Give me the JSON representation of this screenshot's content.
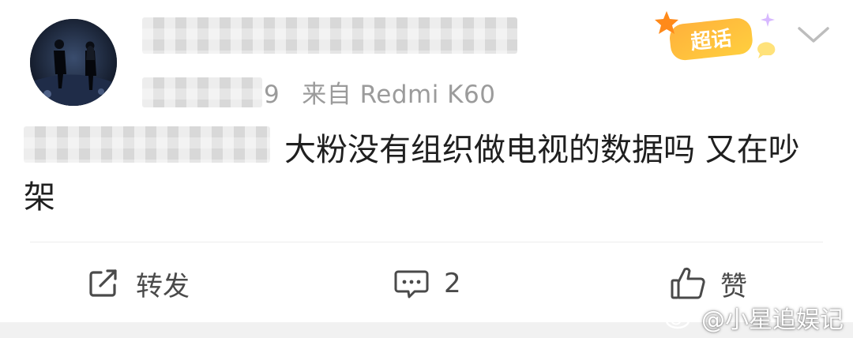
{
  "post": {
    "meta_suffix": "9",
    "source_prefix": "来自",
    "device": "Redmi K60",
    "badge_label": "超话",
    "content": "大粉没有组织做电视的数据吗 又在吵架"
  },
  "actions": {
    "repost_label": "转发",
    "comment_count": "2",
    "like_label": "赞"
  },
  "watermark": {
    "text": "@小星追娱记"
  },
  "colors": {
    "meta": "#9b9b9b",
    "content": "#1f1f1f",
    "badge_orange": "#ff9f1a",
    "badge_gold": "#ffd23a"
  }
}
